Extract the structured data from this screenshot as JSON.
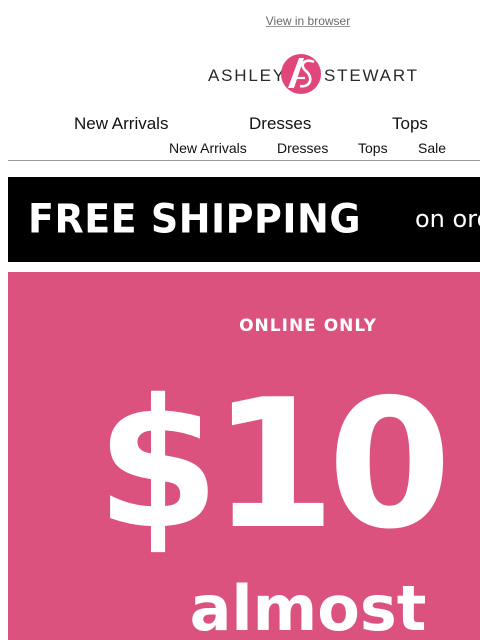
{
  "header": {
    "view_in_browser": "View in browser",
    "brand_left": "ASHLEY",
    "brand_right": "STEWART",
    "brand_mark": "AS"
  },
  "nav_primary": [
    "New Arrivals",
    "Dresses",
    "Tops"
  ],
  "nav_secondary": [
    "New Arrivals",
    "Dresses",
    "Tops",
    "Sale"
  ],
  "shipping_banner": {
    "headline": "FREE SHIPPING",
    "subtext": "on ord"
  },
  "promo": {
    "eyebrow": "ONLINE ONLY",
    "price": "$10 -",
    "subtext": "almost"
  },
  "colors": {
    "promo_bg": "#dc527f",
    "brand_pink": "#e0457b",
    "banner_bg": "#000000"
  }
}
